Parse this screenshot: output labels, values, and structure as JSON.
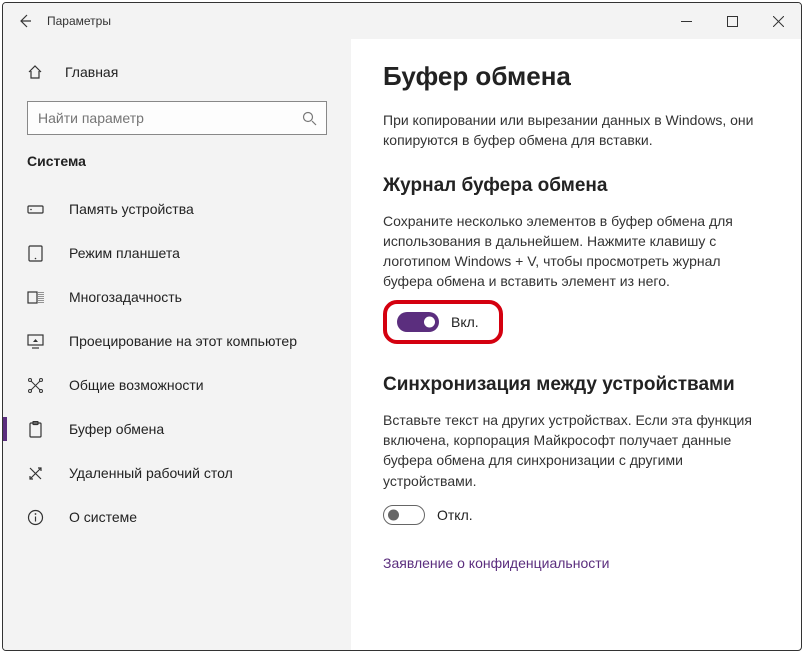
{
  "window": {
    "title": "Параметры"
  },
  "sidebar": {
    "home": "Главная",
    "search_placeholder": "Найти параметр",
    "section": "Система",
    "items": [
      {
        "label": "Память устройства"
      },
      {
        "label": "Режим планшета"
      },
      {
        "label": "Многозадачность"
      },
      {
        "label": "Проецирование на этот компьютер"
      },
      {
        "label": "Общие возможности"
      },
      {
        "label": "Буфер обмена"
      },
      {
        "label": "Удаленный рабочий стол"
      },
      {
        "label": "О системе"
      }
    ]
  },
  "content": {
    "title": "Буфер обмена",
    "intro": "При копировании или вырезании данных в Windows, они копируются в буфер обмена для вставки.",
    "section1_title": "Журнал буфера обмена",
    "section1_desc": "Сохраните несколько элементов в буфер обмена для использования в дальнейшем. Нажмите клавишу с логотипом Windows + V, чтобы просмотреть журнал буфера обмена и вставить элемент из него.",
    "toggle1_label": "Вкл.",
    "section2_title": "Синхронизация между устройствами",
    "section2_desc": "Вставьте текст на других устройствах. Если эта функция включена, корпорация Майкрософт получает данные буфера обмена для синхронизации с другими устройствами.",
    "toggle2_label": "Откл.",
    "privacy_link": "Заявление о конфиденциальности"
  }
}
